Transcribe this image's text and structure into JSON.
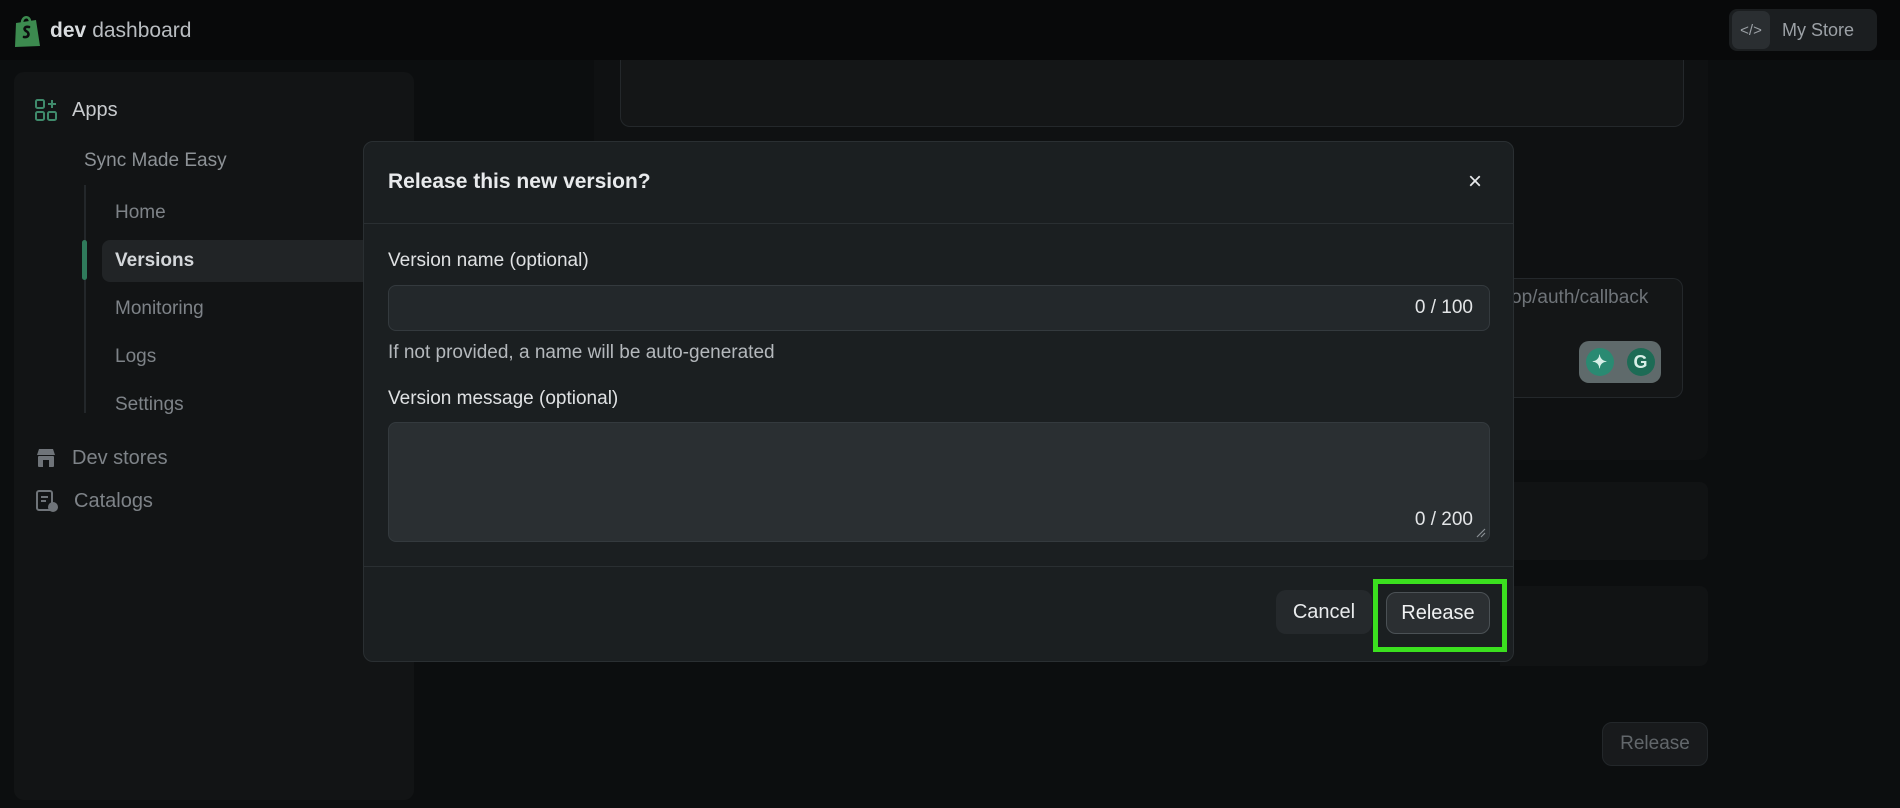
{
  "topbar": {
    "brand_bold": "dev",
    "brand_rest": "dashboard",
    "store_label": "My Store"
  },
  "sidebar": {
    "apps_label": "Apps",
    "app_name": "Sync Made Easy",
    "sub_items": [
      "Home",
      "Versions",
      "Monitoring",
      "Logs",
      "Settings"
    ],
    "active_sub_item": "Versions",
    "dev_stores_label": "Dev stores",
    "catalogs_label": "Catalogs"
  },
  "background": {
    "url_fragment": "op/auth/callback",
    "release_label": "Release"
  },
  "modal": {
    "title": "Release this new version?",
    "close_glyph": "×",
    "version_name_label": "Version name (optional)",
    "version_name_value": "",
    "version_name_counter": "0 / 100",
    "version_name_hint": "If not provided, a name will be auto-generated",
    "version_message_label": "Version message (optional)",
    "version_message_value": "",
    "version_message_counter": "0 / 200",
    "cancel_label": "Cancel",
    "release_label": "Release"
  },
  "colors": {
    "accent_green": "#2f7a5b",
    "highlight": "#3be01f"
  }
}
